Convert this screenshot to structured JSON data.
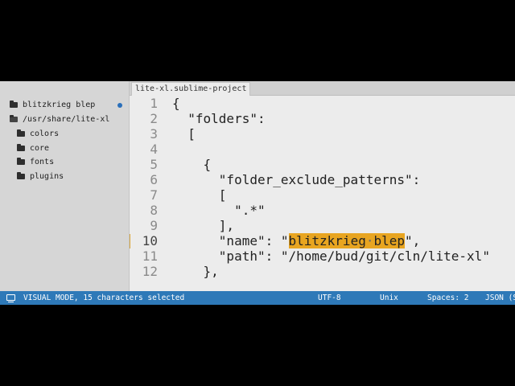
{
  "sidebar": {
    "items": [
      {
        "label": "blitzkrieg blep",
        "icon": "folder-icon",
        "modified": true
      },
      {
        "label": "/usr/share/lite-xl",
        "icon": "folder-open-icon"
      },
      {
        "label": "colors",
        "icon": "folder-icon"
      },
      {
        "label": "core",
        "icon": "folder-icon"
      },
      {
        "label": "fonts",
        "icon": "folder-icon"
      },
      {
        "label": "plugins",
        "icon": "folder-icon"
      }
    ]
  },
  "tabs": [
    {
      "label": "lite-xl.sublime-project",
      "active": true
    }
  ],
  "editor": {
    "current_line": 10,
    "line_numbers": [
      "1",
      "2",
      "3",
      "4",
      "5",
      "6",
      "7",
      "8",
      "9",
      "10",
      "11",
      "12"
    ],
    "lines": [
      "{",
      "  \"folders\":",
      "  [",
      "",
      "    {",
      "      \"folder_exclude_patterns\":",
      "      [",
      "        \".*\"",
      "      ],",
      "",
      "      \"path\": \"/home/bud/git/cln/lite-xl\"",
      "    },"
    ],
    "line10": {
      "before": "      \"name\": \"",
      "sel_a": "blitzkrieg",
      "sel_dot": "·",
      "sel_b": "blep",
      "after": "\","
    }
  },
  "statusbar": {
    "icon": "terminal-icon",
    "mode": "VISUAL MODE, 15 characters selected",
    "encoding": "UTF-8",
    "line_ending": "Unix",
    "indent": "Spaces: 2",
    "language": "JSON (S"
  },
  "colors": {
    "status_bar": "#2e79b8",
    "selection": "#e8a521",
    "modified_dot": "#2a6fba",
    "line_marker": "#d9a53a"
  }
}
